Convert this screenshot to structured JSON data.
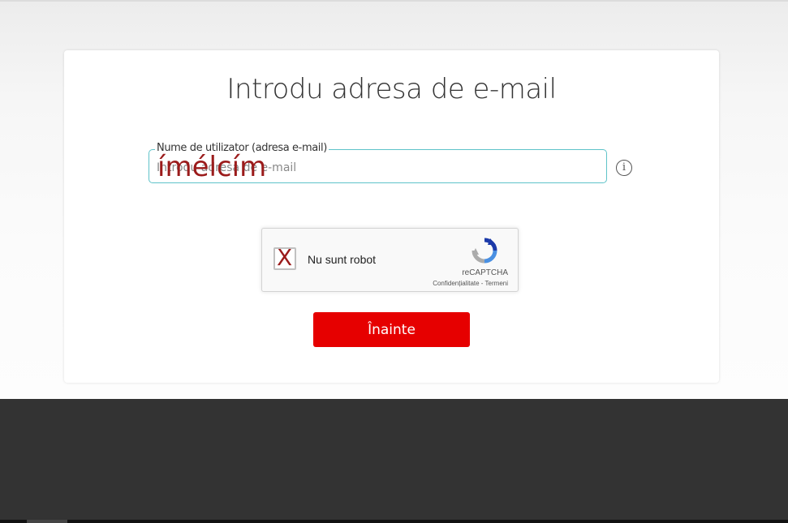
{
  "title": "Introdu adresa de e-mail",
  "email_field": {
    "label": "Nume de utilizator (adresa e-mail)",
    "placeholder": "Introdu adresa de e-mail",
    "value": "",
    "overlay_text": "ímélcím"
  },
  "info_icon": "info-circle-icon",
  "recaptcha": {
    "checkbox_mark": "X",
    "label": "Nu sunt robot",
    "brand": "reCAPTCHA",
    "privacy_link": "Confidențialitate",
    "separator": " - ",
    "terms_link": "Termeni"
  },
  "submit_label": "Înainte",
  "colors": {
    "accent_red": "#e60000",
    "field_border": "#5fc3c9",
    "overlay_text": "#9b1b1b",
    "footer": "#333333"
  }
}
